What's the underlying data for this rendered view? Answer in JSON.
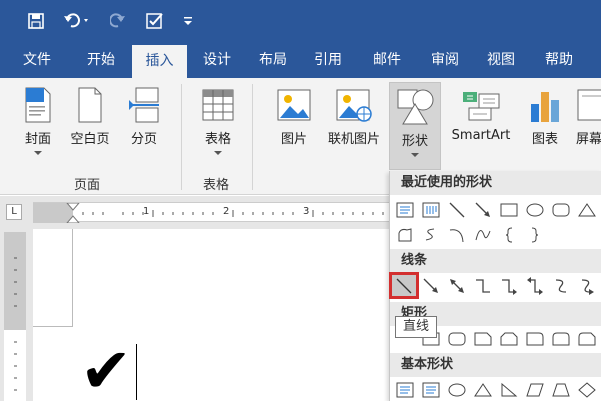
{
  "colors": {
    "accent": "#2b579a",
    "selection": "#d32f2f"
  },
  "quick_access": [
    {
      "name": "save-icon"
    },
    {
      "name": "undo-icon"
    },
    {
      "name": "redo-icon"
    },
    {
      "name": "checklist-icon"
    },
    {
      "name": "customize-toolbar-icon"
    }
  ],
  "tabs": [
    "文件",
    "开始",
    "插入",
    "设计",
    "布局",
    "引用",
    "邮件",
    "审阅",
    "视图",
    "帮助"
  ],
  "active_tab": "插入",
  "ribbon": {
    "cover": "封面",
    "blank_page": "空白页",
    "page_break": "分页",
    "table": "表格",
    "picture": "图片",
    "online_picture": "联机图片",
    "shapes": "形状",
    "smartart": "SmartArt",
    "chart": "图表",
    "screenshot": "屏幕",
    "groups": {
      "pages": "页面",
      "tables": "表格"
    }
  },
  "ruler": {
    "corner": "L",
    "numbers": [
      "1",
      "2",
      "3"
    ]
  },
  "document": {
    "content": "✔"
  },
  "shapes_gallery": {
    "recent_header": "最近使用的形状",
    "lines_header": "线条",
    "rect_header": "矩形",
    "basic_header": "基本形状",
    "tooltip": "直线",
    "recent_row1": [
      "text-box-icon",
      "vertical-text-box-icon",
      "line-icon",
      "arrow-icon",
      "rectangle-icon",
      "oval-icon",
      "rounded-rectangle-icon",
      "triangle-icon"
    ],
    "recent_row2": [
      "freeform-icon",
      "scribble-icon",
      "arc-icon",
      "curve-icon",
      "left-brace-icon",
      "right-brace-icon"
    ],
    "lines_row": [
      "line-icon",
      "arrow-icon",
      "double-arrow-icon",
      "elbow-connector-icon",
      "elbow-arrow-connector-icon",
      "elbow-double-arrow-connector-icon",
      "curved-connector-icon",
      "curved-arrow-connector-icon"
    ],
    "basic_row": [
      "text-box-icon",
      "oval-icon",
      "triangle-icon",
      "right-triangle-icon",
      "parallelogram-icon",
      "trapezoid-icon",
      "diamond-icon"
    ]
  }
}
